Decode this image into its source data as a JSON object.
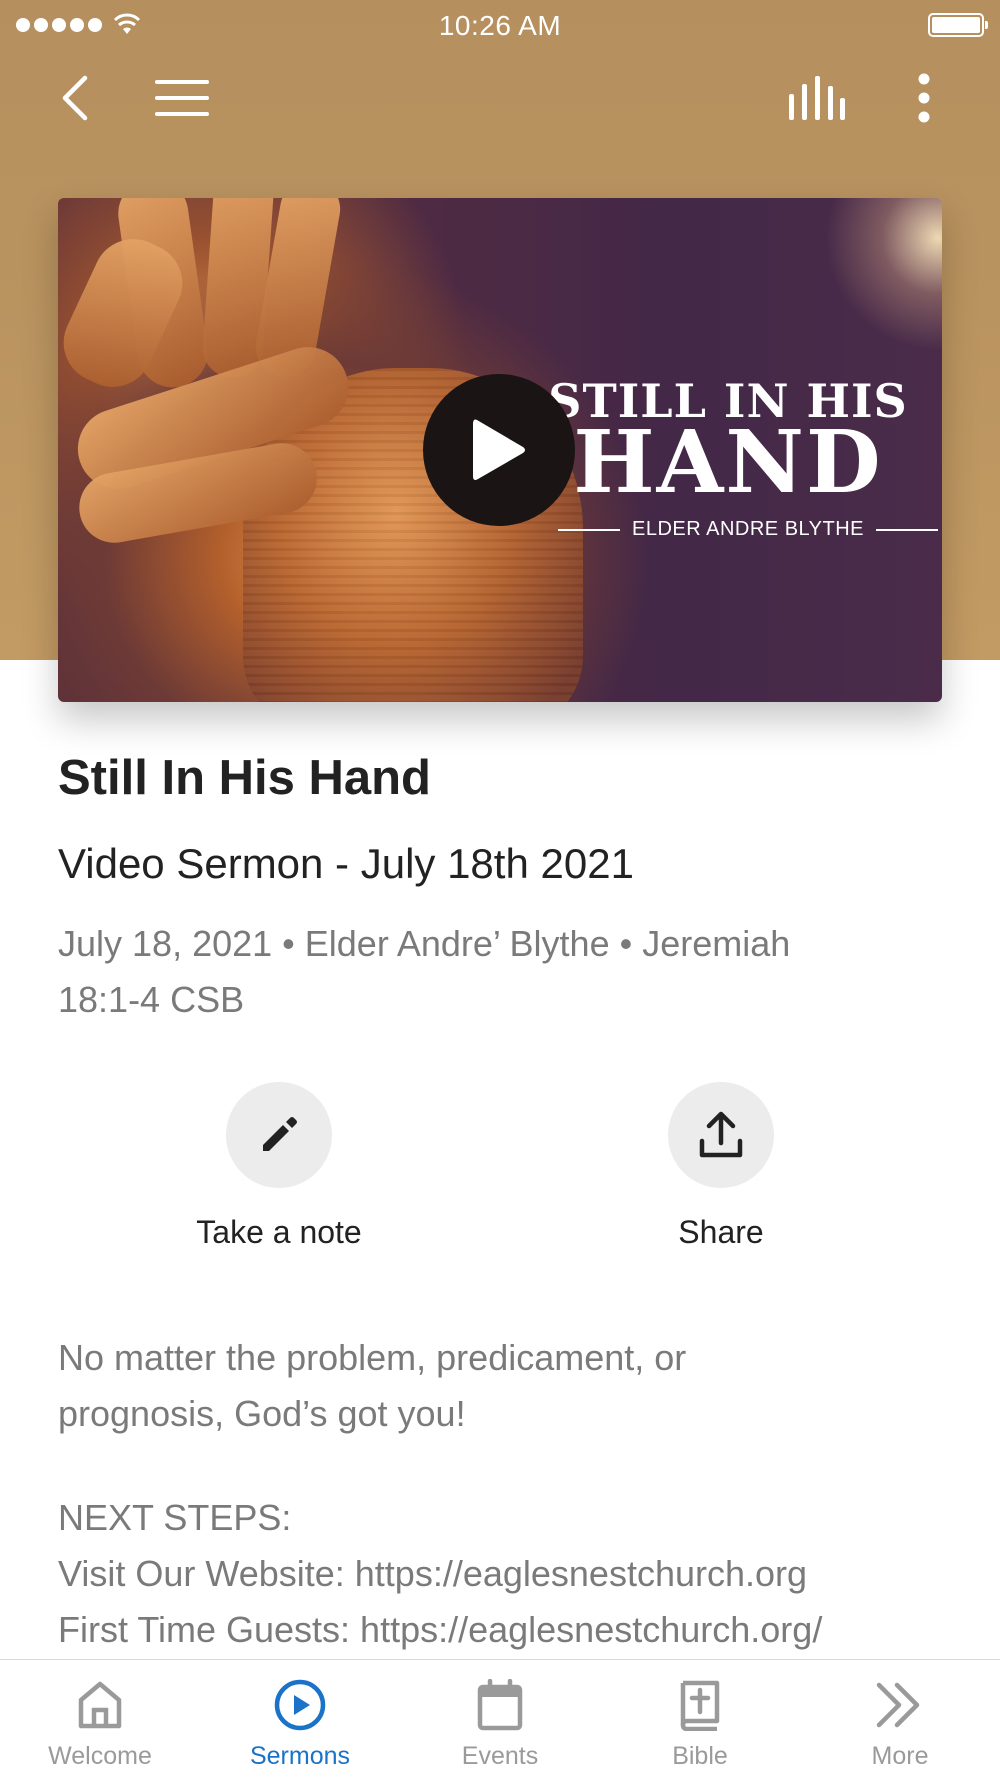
{
  "status_bar": {
    "time": "10:26 AM"
  },
  "nav": {
    "back": "back-icon",
    "menu": "menu-icon",
    "audio": "audio-bars-icon",
    "more": "more-vertical-icon"
  },
  "video": {
    "title_line1": "STILL IN HIS",
    "title_line2": "HAND",
    "preacher": "ELDER ANDRE BLYTHE"
  },
  "sermon": {
    "title": "Still In His Hand",
    "subtitle": "Video Sermon - July 18th 2021",
    "meta_line1": "July 18, 2021 • Elder Andre’ Blythe • Jeremiah",
    "meta_line2": "18:1-4 CSB"
  },
  "actions": {
    "note_label": "Take a note",
    "share_label": "Share"
  },
  "description": {
    "line1": "No matter the problem, predicament, or",
    "line2": "prognosis, God’s got you!"
  },
  "next_steps": {
    "heading": "NEXT STEPS:",
    "website": "Visit Our Website: https://eaglesnestchurch.org",
    "guests": "First Time Guests: https://eaglesnestchurch.org/"
  },
  "tabs": [
    {
      "label": "Welcome",
      "icon": "home-icon",
      "active": false
    },
    {
      "label": "Sermons",
      "icon": "play-circle-icon",
      "active": true
    },
    {
      "label": "Events",
      "icon": "calendar-icon",
      "active": false
    },
    {
      "label": "Bible",
      "icon": "bible-icon",
      "active": false
    },
    {
      "label": "More",
      "icon": "double-chevron-icon",
      "active": false
    }
  ],
  "colors": {
    "header_bg": "#b9935f",
    "accent": "#1a73c8",
    "tab_inactive": "#9a9a9a"
  }
}
